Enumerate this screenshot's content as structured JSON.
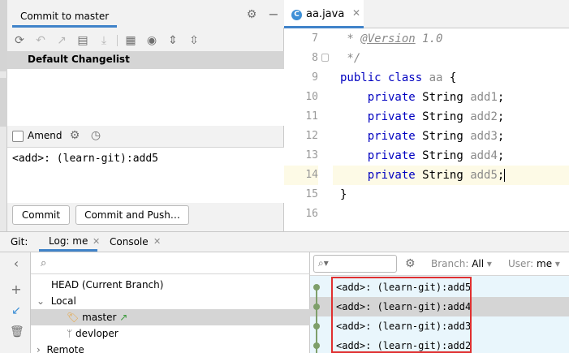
{
  "commit_panel": {
    "title": "Commit to master",
    "changelist": "Default Changelist",
    "amend_label": "Amend",
    "commit_message": "<add>: (learn-git):add5",
    "commit_button": "Commit",
    "commit_push_button": "Commit and Push…"
  },
  "editor": {
    "file_tab": "aa.java",
    "file_icon_letter": "C",
    "line_numbers": [
      "7",
      "8",
      "9",
      "10",
      "11",
      "12",
      "13",
      "14",
      "15",
      "16"
    ],
    "lines": [
      {
        "comment": " * ",
        "tag": "@Version",
        "rest": " 1.0"
      },
      {
        "comment": " */"
      },
      {
        "kw1": "public",
        "kw2": "class",
        "name": "aa",
        "rest": " {"
      },
      {
        "indent": "    ",
        "kw1": "private",
        "type": "String",
        "field": "add1",
        "rest": ";"
      },
      {
        "indent": "    ",
        "kw1": "private",
        "type": "String",
        "field": "add2",
        "rest": ";"
      },
      {
        "indent": "    ",
        "kw1": "private",
        "type": "String",
        "field": "add3",
        "rest": ";"
      },
      {
        "indent": "    ",
        "kw1": "private",
        "type": "String",
        "field": "add4",
        "rest": ";"
      },
      {
        "indent": "    ",
        "kw1": "private",
        "type": "String",
        "field": "add5",
        "rest": ";"
      },
      {
        "rest": "}"
      },
      {
        "rest": ""
      }
    ],
    "current_line": "14"
  },
  "git": {
    "label": "Git:",
    "log_tab": "Log: me",
    "console_tab": "Console",
    "branches": {
      "head": "HEAD (Current Branch)",
      "local": "Local",
      "master": "master",
      "devloper": "devloper",
      "remote": "Remote"
    },
    "filters": {
      "branch_label": "Branch:",
      "branch_value": "All",
      "user_label": "User:",
      "user_value": "me"
    },
    "commits": [
      "<add>: (learn-git):add5",
      "<add>: (learn-git):add4",
      "<add>: (learn-git):add3",
      "<add>: (learn-git):add2"
    ]
  },
  "colors": {
    "accent": "#4083c9",
    "keyword": "#0000c0",
    "graph": "#7e9f6a",
    "highlight": "#e03030",
    "log_background": "#e9f6fc"
  }
}
